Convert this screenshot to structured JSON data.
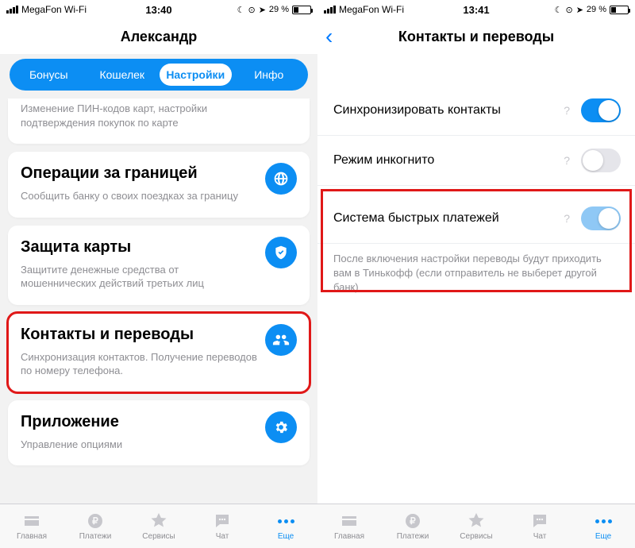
{
  "left": {
    "status": {
      "carrier": "MegaFon Wi-Fi",
      "time": "13:40",
      "battery": "29 %"
    },
    "title": "Александр",
    "tabs": [
      "Бонусы",
      "Кошелек",
      "Настройки",
      "Инфо"
    ],
    "card0_sub": "Изменение ПИН-кодов карт, настройки подтверждения покупок по карте",
    "card1": {
      "title": "Операции за границей",
      "sub": "Сообщить банку о своих поездках за границу"
    },
    "card2": {
      "title": "Защита карты",
      "sub": "Защитите денежные средства от мошеннических действий третьих лиц"
    },
    "card3": {
      "title": "Контакты и переводы",
      "sub": "Синхронизация контактов. Получение переводов по номеру телефона."
    },
    "card4": {
      "title": "Приложение",
      "sub": "Управление опциями"
    }
  },
  "right": {
    "status": {
      "carrier": "MegaFon Wi-Fi",
      "time": "13:41",
      "battery": "29 %"
    },
    "title": "Контакты и переводы",
    "row1": "Синхронизировать контакты",
    "row2": "Режим инкогнито",
    "row3": "Система быстрых платежей",
    "footer": "После включения настройки переводы будут приходить вам в Тинькофф (если отправитель не выберет другой банк)",
    "help": "?"
  },
  "tabs": [
    "Главная",
    "Платежи",
    "Сервисы",
    "Чат",
    "Еще"
  ]
}
